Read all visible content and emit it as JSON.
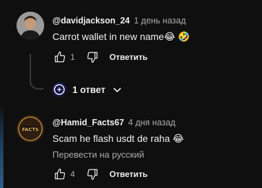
{
  "comments": [
    {
      "author": "@davidjackson_24",
      "time": "1 день назад",
      "text": "Carrot wallet in new name😂 🤣",
      "likes": "1",
      "reply_label": "Ответить"
    },
    {
      "author": "@Hamid_Facts67",
      "time": "4 дня назад",
      "text": "Scam he flash usdt de raha 😂",
      "translate": "Перевести на русский",
      "likes": "4",
      "reply_label": "Ответить",
      "avatar_text": "FACTS"
    }
  ],
  "replies": {
    "label": "1 ответ"
  },
  "colors": {
    "background": "#0f0f0f",
    "primary_text": "#f1f1f1",
    "secondary_text": "#aaaaaa"
  }
}
